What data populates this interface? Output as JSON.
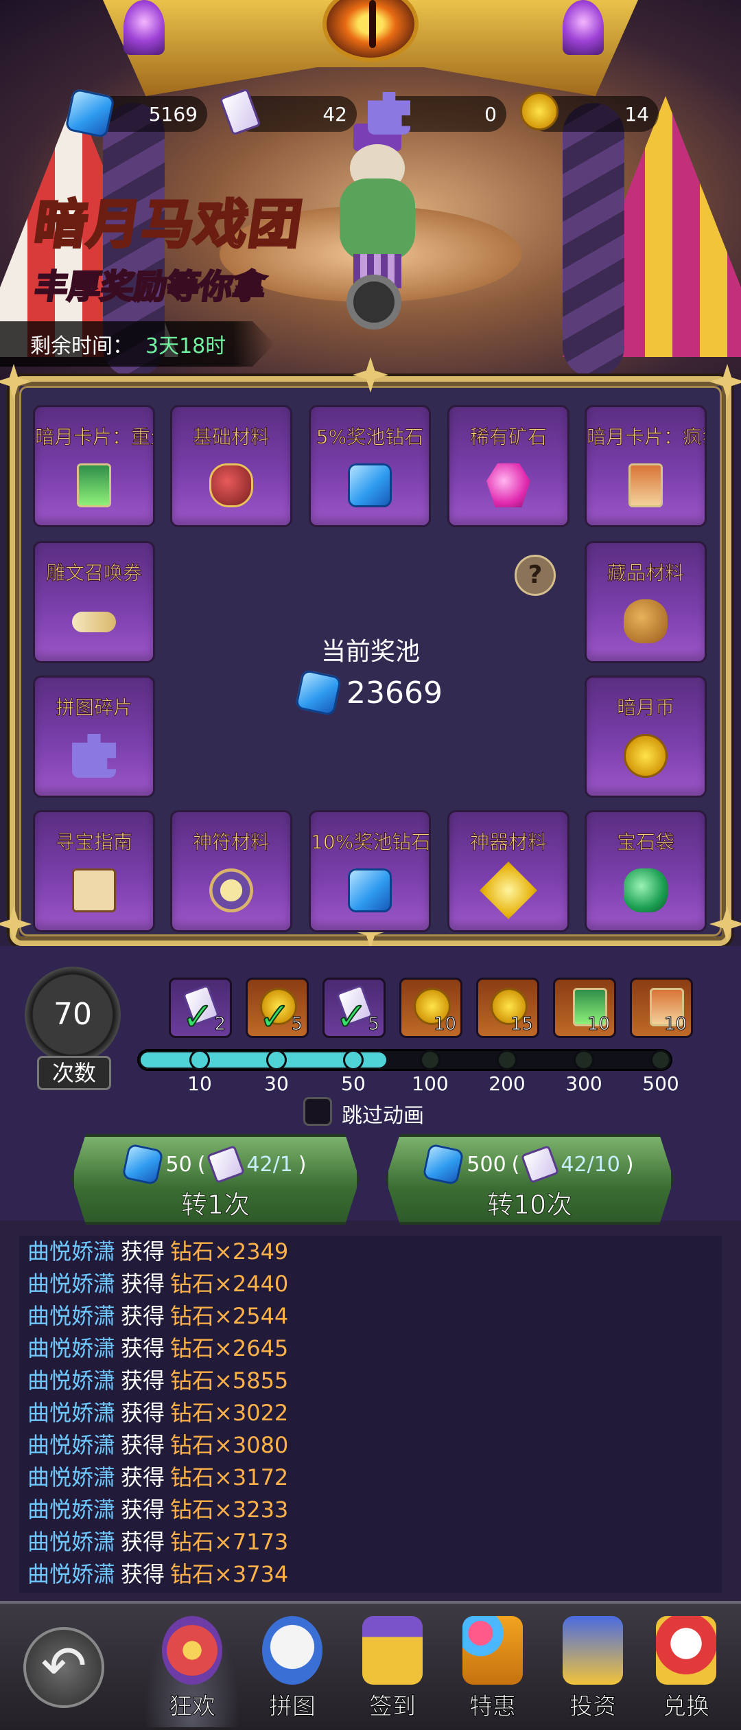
{
  "header": {
    "title": "暗月马戏团",
    "subtitle": "丰厚奖励等你拿",
    "timer_label": "剩余时间：",
    "timer_value": "3天18时"
  },
  "currencies": [
    {
      "icon": "diamond-icon",
      "value": "5169"
    },
    {
      "icon": "ticket-icon",
      "value": "42"
    },
    {
      "icon": "puzzle-piece-icon",
      "value": "0"
    },
    {
      "icon": "dark-moon-coin-icon",
      "value": "14"
    }
  ],
  "prizes": [
    {
      "label": "暗月卡片：重生",
      "icon": "card-icon"
    },
    {
      "label": "基础材料",
      "icon": "material-icon"
    },
    {
      "label": "5%奖池钻石",
      "icon": "diamond-icon"
    },
    {
      "label": "稀有矿石",
      "icon": "ore-icon"
    },
    {
      "label": "暗月卡片：疯狂",
      "icon": "card-icon"
    },
    {
      "label": "雕文召唤券",
      "icon": "scroll-icon"
    },
    {
      "label": "藏品材料",
      "icon": "bag-icon"
    },
    {
      "label": "拼图碎片",
      "icon": "puzzle-piece-icon"
    },
    {
      "label": "暗月币",
      "icon": "dark-moon-coin-icon"
    },
    {
      "label": "寻宝指南",
      "icon": "map-icon"
    },
    {
      "label": "神符材料",
      "icon": "rune-icon"
    },
    {
      "label": "10%奖池钻石",
      "icon": "diamond-icon"
    },
    {
      "label": "神器材料",
      "icon": "relic-icon"
    },
    {
      "label": "宝石袋",
      "icon": "gem-bag-icon"
    }
  ],
  "pool": {
    "label": "当前奖池",
    "value": "23669"
  },
  "spin_count": {
    "value": "70",
    "label": "次数"
  },
  "milestones": [
    {
      "threshold": "10",
      "reward_count": "2",
      "reward_icon": "ticket-icon",
      "claimed": true
    },
    {
      "threshold": "30",
      "reward_count": "5",
      "reward_icon": "dark-moon-coin-icon",
      "claimed": true
    },
    {
      "threshold": "50",
      "reward_count": "5",
      "reward_icon": "ticket-icon",
      "claimed": true
    },
    {
      "threshold": "100",
      "reward_count": "10",
      "reward_icon": "dark-moon-coin-icon",
      "claimed": false
    },
    {
      "threshold": "200",
      "reward_count": "15",
      "reward_icon": "dark-moon-coin-icon",
      "claimed": false
    },
    {
      "threshold": "300",
      "reward_count": "10",
      "reward_icon": "card-icon",
      "claimed": false
    },
    {
      "threshold": "500",
      "reward_count": "10",
      "reward_icon": "card-icon",
      "claimed": false
    }
  ],
  "progress": {
    "current": 70
  },
  "skip_animation_label": "跳过动画",
  "spin_buttons": [
    {
      "label": "转1次",
      "diamond_cost": "50",
      "owned": "42/1"
    },
    {
      "label": "转10次",
      "diamond_cost": "500",
      "owned": "42/10"
    }
  ],
  "log": {
    "entries": [
      {
        "user": "曲悦娇潇",
        "action": "获得",
        "reward": "钻石×2349"
      },
      {
        "user": "曲悦娇潇",
        "action": "获得",
        "reward": "钻石×2440"
      },
      {
        "user": "曲悦娇潇",
        "action": "获得",
        "reward": "钻石×2544"
      },
      {
        "user": "曲悦娇潇",
        "action": "获得",
        "reward": "钻石×2645"
      },
      {
        "user": "曲悦娇潇",
        "action": "获得",
        "reward": "钻石×5855"
      },
      {
        "user": "曲悦娇潇",
        "action": "获得",
        "reward": "钻石×3022"
      },
      {
        "user": "曲悦娇潇",
        "action": "获得",
        "reward": "钻石×3080"
      },
      {
        "user": "曲悦娇潇",
        "action": "获得",
        "reward": "钻石×3172"
      },
      {
        "user": "曲悦娇潇",
        "action": "获得",
        "reward": "钻石×3233"
      },
      {
        "user": "曲悦娇潇",
        "action": "获得",
        "reward": "钻石×7173"
      },
      {
        "user": "曲悦娇潇",
        "action": "获得",
        "reward": "钻石×3734"
      }
    ]
  },
  "nav": {
    "back_icon": "back-arrow-icon",
    "items": [
      {
        "label": "狂欢",
        "icon": "ferris-wheel-icon",
        "active": true
      },
      {
        "label": "拼图",
        "icon": "clown-face-icon",
        "active": false
      },
      {
        "label": "签到",
        "icon": "calendar-icon",
        "active": false
      },
      {
        "label": "特惠",
        "icon": "gift-balloon-icon",
        "active": false
      },
      {
        "label": "投资",
        "icon": "jester-icon",
        "active": false
      },
      {
        "label": "兑换",
        "icon": "clown-exchange-icon",
        "active": false
      }
    ]
  },
  "colors": {
    "board_bg": "#332a52",
    "tile_purple": "#7a3fab",
    "gold_label": "#ffd27a",
    "timer_green": "#6ff1a0",
    "progress_fill": "#4fd3d6",
    "log_user": "#6fc9ff",
    "log_reward": "#ffb14a",
    "spin_green": "#3b6d33"
  }
}
